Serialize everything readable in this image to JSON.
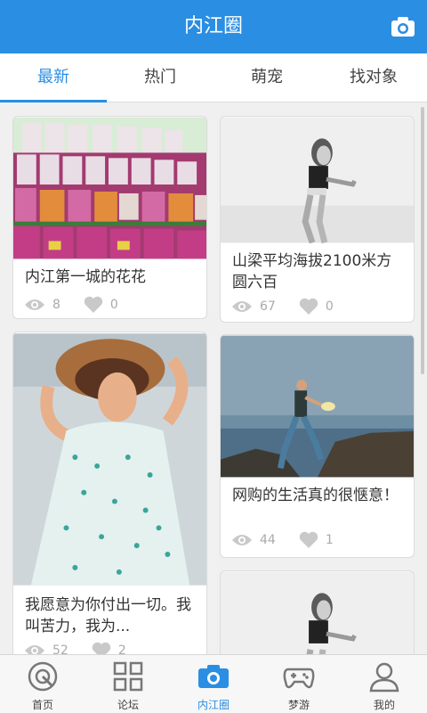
{
  "header": {
    "title": "内江圈",
    "camera_icon": "camera-icon",
    "bg_color": "#2a8ee3"
  },
  "tabs": [
    {
      "label": "最新",
      "active": true
    },
    {
      "label": "热门",
      "active": false
    },
    {
      "label": "萌宠",
      "active": false
    },
    {
      "label": "找对象",
      "active": false
    }
  ],
  "posts": [
    {
      "caption": "内江第一城的花花",
      "views": "8",
      "likes": "0",
      "image": "flower-pots-photo"
    },
    {
      "caption": "山梁平均海拔2100米方圆六百",
      "views": "67",
      "likes": "0",
      "image": "woman-bw-photo"
    },
    {
      "caption": "我愿意为你付出一切。我叫苦力，我为...",
      "views": "52",
      "likes": "2",
      "image": "woman-sunhat-photo"
    },
    {
      "caption": "网购的生活真的很惬意！",
      "views": "44",
      "likes": "1",
      "image": "woman-seaside-photo"
    },
    {
      "caption": "",
      "views": "",
      "likes": "",
      "image": "woman-bw-photo"
    }
  ],
  "bottom_nav": [
    {
      "label": "首页",
      "icon": "home-icon",
      "active": false
    },
    {
      "label": "论坛",
      "icon": "grid-icon",
      "active": false
    },
    {
      "label": "内江圈",
      "icon": "camera-icon",
      "active": true
    },
    {
      "label": "梦游",
      "icon": "gamepad-icon",
      "active": false
    },
    {
      "label": "我的",
      "icon": "user-icon",
      "active": false
    }
  ],
  "accent_color": "#2a8ee3"
}
